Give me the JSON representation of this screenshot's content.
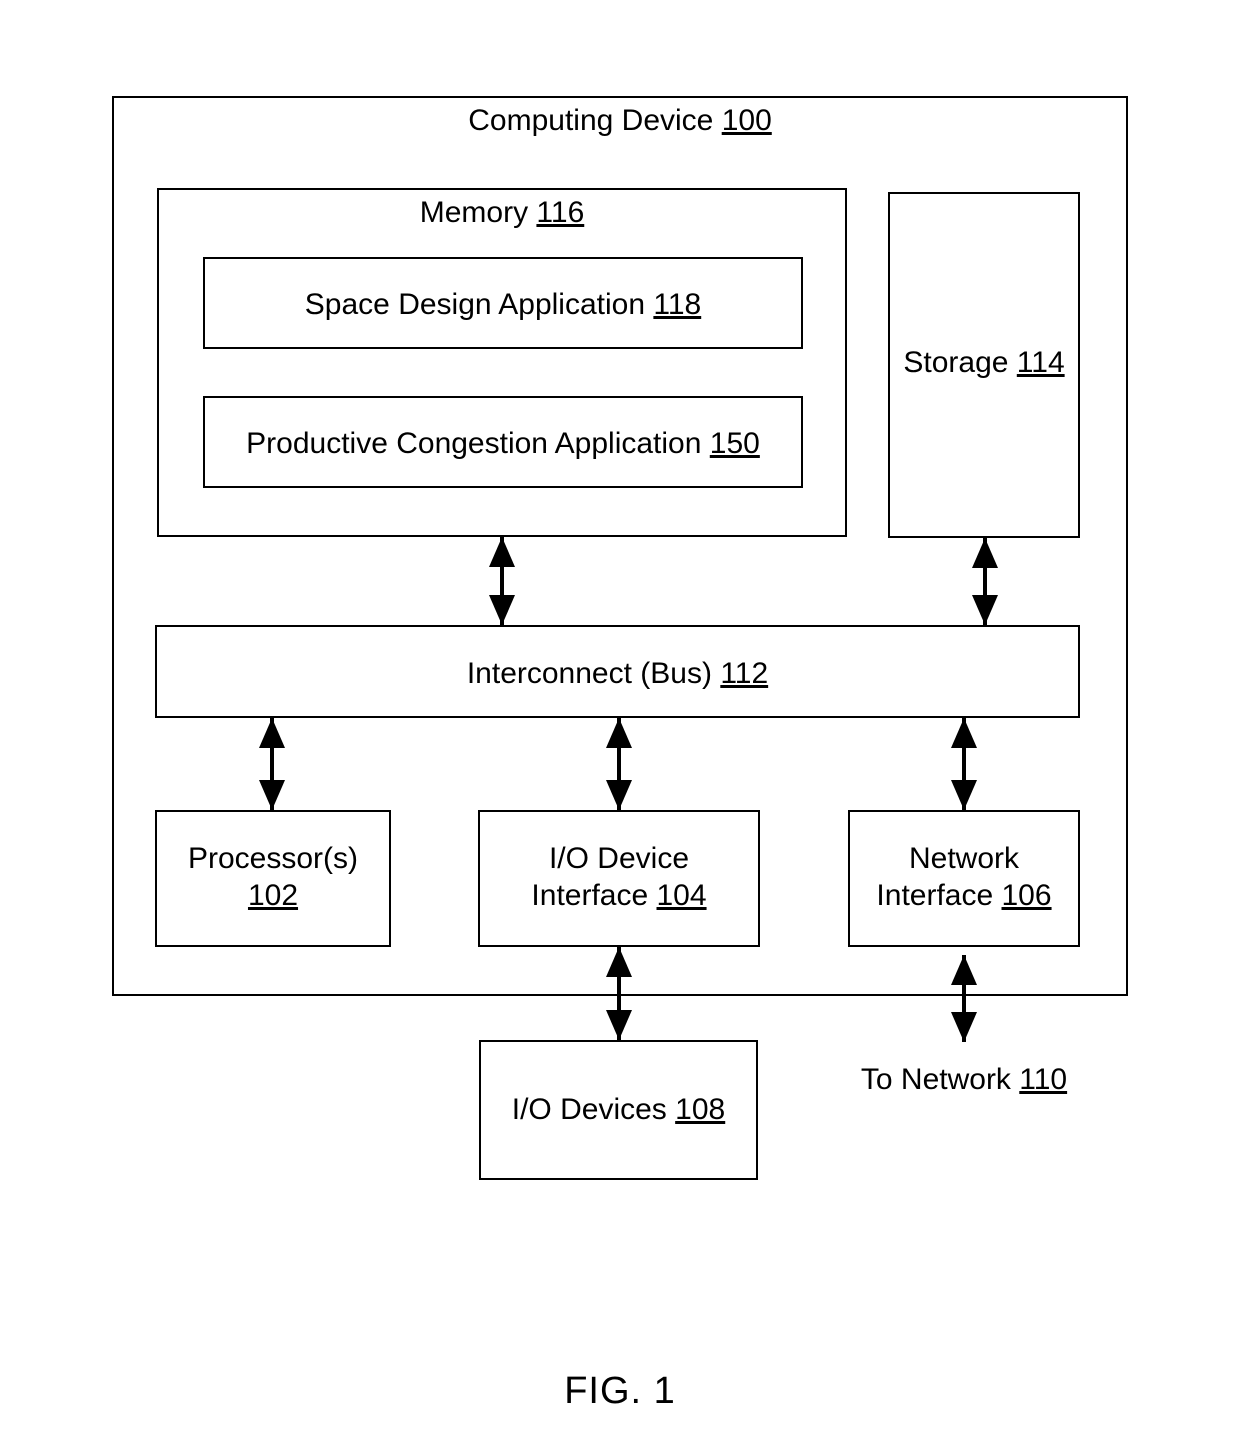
{
  "figure": {
    "caption": "FIG. 1"
  },
  "computing_device": {
    "name": "Computing Device",
    "ref": "100",
    "memory": {
      "name": "Memory",
      "ref": "116",
      "components": [
        {
          "name": "Space Design Application",
          "ref": "118"
        },
        {
          "name": "Productive Congestion Application",
          "ref": "150"
        }
      ]
    },
    "storage": {
      "name": "Storage",
      "ref": "114"
    },
    "interconnect": {
      "name": "Interconnect (Bus)",
      "ref": "112"
    },
    "peripherals": [
      {
        "name": "Processor(s)",
        "ref": "102",
        "line1": "Processor(s)",
        "line2": "102"
      },
      {
        "name": "I/O Device Interface",
        "ref": "104",
        "line1": "I/O Device",
        "line2": "Interface ",
        "line2_ref": "104"
      },
      {
        "name": "Network Interface",
        "ref": "106",
        "line1": "Network",
        "line2": "Interface ",
        "line2_ref": "106"
      }
    ]
  },
  "external": {
    "io_devices": {
      "name": "I/O Devices",
      "ref": "108"
    },
    "to_network": {
      "name": "To Network",
      "ref": "110"
    }
  },
  "connections": [
    {
      "from": "memory",
      "to": "interconnect",
      "style": "double-arrow"
    },
    {
      "from": "storage",
      "to": "interconnect",
      "style": "double-arrow"
    },
    {
      "from": "interconnect",
      "to": "processor",
      "style": "double-arrow"
    },
    {
      "from": "interconnect",
      "to": "io-device-interface",
      "style": "double-arrow"
    },
    {
      "from": "interconnect",
      "to": "network-interface",
      "style": "double-arrow"
    },
    {
      "from": "io-device-interface",
      "to": "io-devices",
      "style": "double-arrow"
    },
    {
      "from": "network-interface",
      "to": "to-network",
      "style": "double-arrow"
    }
  ],
  "style": {
    "stroke": "#000000",
    "background": "#ffffff"
  }
}
